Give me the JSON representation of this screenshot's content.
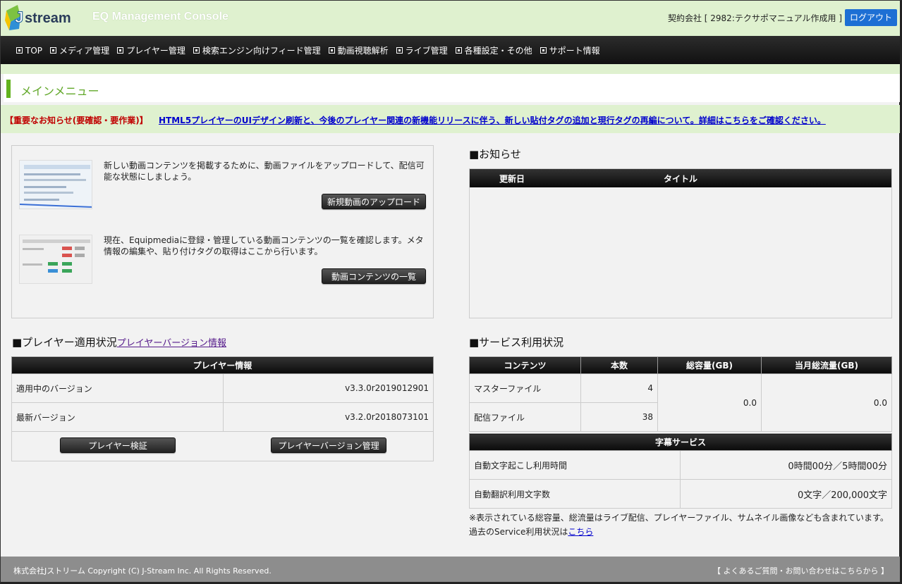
{
  "header": {
    "logo_text": "Jstream",
    "app_title": "EQ Management Console",
    "contract_label": "契約会社 [ 2982:テクサポマニュアル作成用 ]",
    "logout_label": "ログアウト"
  },
  "nav": {
    "items": [
      "TOP",
      "メディア管理",
      "プレイヤー管理",
      "検索エンジン向けフィード管理",
      "動画視聴解析",
      "ライブ管理",
      "各種設定・その他",
      "サポート情報"
    ]
  },
  "menu_title": "メインメニュー",
  "notice": {
    "label": "【重要なお知らせ(要確認・要作業)】",
    "link": "HTML5プレイヤーのUIデザイン刷新と、今後のプレイヤー関連の新機能リリースに伴う、新しい貼付タグの追加と現行タグの再編について。詳細はこちらをご確認ください。"
  },
  "upload_box": {
    "upload_text": "新しい動画コンテンツを掲載するために、動画ファイルをアップロードして、配信可能な状態にしましょう。",
    "upload_button": "新規動画のアップロード",
    "list_text": "現在、Equipmediaに登録・管理している動画コンテンツの一覧を確認します。メタ情報の編集や、貼り付けタグの取得はここから行います。",
    "list_button": "動画コンテンツの一覧"
  },
  "news": {
    "title": "■お知らせ",
    "col_date": "更新日",
    "col_title": "タイトル"
  },
  "player": {
    "title": "■プレイヤー適用状況",
    "version_link": "プレイヤーバージョン情報",
    "table_header": "プレイヤー情報",
    "rows": [
      {
        "label": "適用中のバージョン",
        "value": "v3.3.0r2019012901"
      },
      {
        "label": "最新バージョン",
        "value": "v3.2.0r2018073101"
      }
    ],
    "verify_button": "プレイヤー検証",
    "manage_button": "プレイヤーバージョン管理"
  },
  "service": {
    "title": "■サービス利用状況",
    "headers": [
      "コンテンツ",
      "本数",
      "総容量(GB)",
      "当月総流量(GB)"
    ],
    "rows": [
      {
        "label": "マスターファイル",
        "count": "4"
      },
      {
        "label": "配信ファイル",
        "count": "38"
      }
    ],
    "total_capacity": "0.0",
    "monthly_traffic": "0.0",
    "caption_header": "字幕サービス",
    "caption_rows": [
      {
        "label": "自動文字起こし利用時間",
        "value": "0時間00分／5時間00分"
      },
      {
        "label": "自動翻訳利用文字数",
        "value": "0文字／200,000文字"
      }
    ],
    "note": "※表示されている総容量、総流量はライブ配信、プレイヤーファイル、サムネイル画像なども含まれています。",
    "history_prefix": "過去のService利用状況は",
    "history_link": "こちら"
  },
  "footer": {
    "copyright": "株式会社Jストリーム  Copyright (C) J-Stream Inc. All Rights Reserved.",
    "faq": "【 よくあるご質問・お問い合わせはこちらから 】"
  },
  "colors": {
    "header_bg": "#dff1cf",
    "accent_green": "#62b21d",
    "notice_red": "#c00000",
    "logout_blue": "#1d6fd4",
    "nav_bg": "#1a1a1a"
  }
}
